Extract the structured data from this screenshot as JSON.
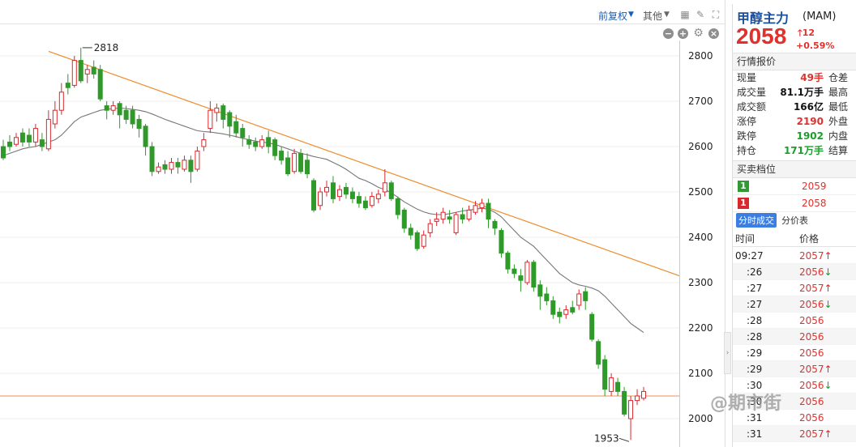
{
  "toolbar": {
    "fuquan_label": "前复权",
    "other_label": "其他"
  },
  "chart_data": {
    "type": "candlestick",
    "ylim": [
      1945,
      2830
    ],
    "yticks": [
      2000,
      2100,
      2200,
      2300,
      2400,
      2500,
      2600,
      2700,
      2800
    ],
    "annotations": [
      {
        "text": "2818",
        "value": 2818
      },
      {
        "text": "1953",
        "value": 1953
      }
    ],
    "candles": [
      [
        2600,
        2575,
        2615,
        2570
      ],
      [
        2610,
        2600,
        2625,
        2590
      ],
      [
        2605,
        2620,
        2630,
        2600
      ],
      [
        2630,
        2610,
        2640,
        2600
      ],
      [
        2625,
        2610,
        2640,
        2600
      ],
      [
        2610,
        2640,
        2650,
        2600
      ],
      [
        2615,
        2600,
        2630,
        2590
      ],
      [
        2595,
        2660,
        2680,
        2590
      ],
      [
        2650,
        2680,
        2700,
        2640
      ],
      [
        2680,
        2720,
        2740,
        2670
      ],
      [
        2740,
        2730,
        2760,
        2715
      ],
      [
        2735,
        2790,
        2800,
        2730
      ],
      [
        2790,
        2745,
        2818,
        2740
      ],
      [
        2760,
        2770,
        2780,
        2740
      ],
      [
        2775,
        2760,
        2790,
        2750
      ],
      [
        2770,
        2705,
        2780,
        2700
      ],
      [
        2690,
        2680,
        2700,
        2660
      ],
      [
        2680,
        2690,
        2700,
        2670
      ],
      [
        2695,
        2670,
        2700,
        2640
      ],
      [
        2680,
        2660,
        2690,
        2650
      ],
      [
        2680,
        2650,
        2690,
        2640
      ],
      [
        2660,
        2640,
        2670,
        2620
      ],
      [
        2645,
        2600,
        2650,
        2580
      ],
      [
        2600,
        2545,
        2610,
        2535
      ],
      [
        2545,
        2555,
        2565,
        2540
      ],
      [
        2560,
        2550,
        2570,
        2540
      ],
      [
        2550,
        2565,
        2575,
        2540
      ],
      [
        2565,
        2555,
        2575,
        2540
      ],
      [
        2550,
        2570,
        2580,
        2545
      ],
      [
        2570,
        2545,
        2580,
        2520
      ],
      [
        2550,
        2590,
        2600,
        2545
      ],
      [
        2600,
        2615,
        2630,
        2590
      ],
      [
        2640,
        2680,
        2700,
        2630
      ],
      [
        2675,
        2685,
        2695,
        2655
      ],
      [
        2690,
        2660,
        2695,
        2640
      ],
      [
        2675,
        2645,
        2680,
        2620
      ],
      [
        2655,
        2630,
        2670,
        2620
      ],
      [
        2640,
        2620,
        2650,
        2600
      ],
      [
        2615,
        2605,
        2625,
        2595
      ],
      [
        2610,
        2600,
        2620,
        2590
      ],
      [
        2600,
        2615,
        2625,
        2595
      ],
      [
        2620,
        2600,
        2635,
        2585
      ],
      [
        2615,
        2580,
        2620,
        2570
      ],
      [
        2590,
        2570,
        2600,
        2560
      ],
      [
        2575,
        2540,
        2590,
        2535
      ],
      [
        2545,
        2585,
        2595,
        2540
      ],
      [
        2585,
        2545,
        2595,
        2540
      ],
      [
        2570,
        2540,
        2585,
        2530
      ],
      [
        2525,
        2460,
        2530,
        2455
      ],
      [
        2470,
        2500,
        2510,
        2460
      ],
      [
        2500,
        2510,
        2525,
        2490
      ],
      [
        2520,
        2485,
        2535,
        2475
      ],
      [
        2490,
        2505,
        2515,
        2480
      ],
      [
        2510,
        2495,
        2520,
        2485
      ],
      [
        2500,
        2485,
        2510,
        2475
      ],
      [
        2490,
        2475,
        2500,
        2465
      ],
      [
        2480,
        2465,
        2490,
        2460
      ],
      [
        2470,
        2490,
        2500,
        2465
      ],
      [
        2485,
        2495,
        2505,
        2475
      ],
      [
        2500,
        2520,
        2550,
        2490
      ],
      [
        2520,
        2485,
        2525,
        2480
      ],
      [
        2485,
        2450,
        2490,
        2440
      ],
      [
        2460,
        2420,
        2465,
        2410
      ],
      [
        2420,
        2405,
        2430,
        2395
      ],
      [
        2410,
        2375,
        2415,
        2370
      ],
      [
        2380,
        2405,
        2415,
        2375
      ],
      [
        2410,
        2430,
        2440,
        2400
      ],
      [
        2435,
        2440,
        2455,
        2425
      ],
      [
        2440,
        2455,
        2465,
        2430
      ],
      [
        2445,
        2440,
        2460,
        2430
      ],
      [
        2410,
        2450,
        2455,
        2405
      ],
      [
        2450,
        2440,
        2465,
        2430
      ],
      [
        2440,
        2460,
        2470,
        2435
      ],
      [
        2455,
        2470,
        2480,
        2450
      ],
      [
        2465,
        2475,
        2485,
        2455
      ],
      [
        2475,
        2440,
        2485,
        2420
      ],
      [
        2435,
        2420,
        2440,
        2405
      ],
      [
        2415,
        2365,
        2420,
        2355
      ],
      [
        2365,
        2330,
        2370,
        2320
      ],
      [
        2330,
        2320,
        2340,
        2310
      ],
      [
        2315,
        2305,
        2330,
        2280
      ],
      [
        2300,
        2345,
        2350,
        2295
      ],
      [
        2345,
        2290,
        2350,
        2280
      ],
      [
        2295,
        2270,
        2305,
        2240
      ],
      [
        2275,
        2260,
        2290,
        2250
      ],
      [
        2260,
        2230,
        2270,
        2220
      ],
      [
        2235,
        2225,
        2245,
        2210
      ],
      [
        2230,
        2240,
        2250,
        2220
      ],
      [
        2245,
        2235,
        2260,
        2230
      ],
      [
        2250,
        2275,
        2285,
        2240
      ],
      [
        2280,
        2260,
        2290,
        2240
      ],
      [
        2230,
        2175,
        2235,
        2170
      ],
      [
        2170,
        2120,
        2175,
        2110
      ],
      [
        2130,
        2065,
        2140,
        2050
      ],
      [
        2060,
        2090,
        2100,
        2050
      ],
      [
        2080,
        2060,
        2090,
        2050
      ],
      [
        2060,
        2010,
        2070,
        2005
      ],
      [
        2000,
        2040,
        2050,
        1953
      ],
      [
        2040,
        2050,
        2065,
        2030
      ],
      [
        2045,
        2060,
        2070,
        2040
      ]
    ],
    "ma": [
      2580,
      2585,
      2590,
      2595,
      2598,
      2600,
      2605,
      2610,
      2615,
      2625,
      2640,
      2655,
      2665,
      2670,
      2675,
      2680,
      2682,
      2684,
      2685,
      2684,
      2682,
      2680,
      2677,
      2672,
      2666,
      2660,
      2655,
      2650,
      2645,
      2640,
      2635,
      2633,
      2632,
      2630,
      2628,
      2625,
      2622,
      2618,
      2615,
      2612,
      2610,
      2608,
      2605,
      2600,
      2595,
      2590,
      2585,
      2582,
      2578,
      2575,
      2572,
      2565,
      2558,
      2550,
      2540,
      2530,
      2525,
      2518,
      2510,
      2505,
      2498,
      2488,
      2478,
      2470,
      2462,
      2456,
      2452,
      2450,
      2450,
      2452,
      2455,
      2458,
      2460,
      2462,
      2464,
      2462,
      2455,
      2445,
      2430,
      2415,
      2400,
      2390,
      2380,
      2365,
      2350,
      2335,
      2320,
      2310,
      2300,
      2295,
      2292,
      2288,
      2282,
      2270,
      2255,
      2240,
      2225,
      2210,
      2200,
      2190
    ],
    "trendline": [
      [
        2810,
        0
      ],
      [
        2315,
        98
      ]
    ],
    "horizontal_line": 2050
  },
  "quote": {
    "name": "甲醇主力",
    "code": "(MAM)",
    "last": "2058",
    "change": "12",
    "change_pct": "+0.59%",
    "section_title": "行情报价",
    "rows": [
      {
        "label": "现量",
        "value": "49手",
        "color": "red",
        "label2": "仓差"
      },
      {
        "label": "成交量",
        "value": "81.1万手",
        "color": "black",
        "label2": "最高"
      },
      {
        "label": "成交额",
        "value": "166亿",
        "color": "black",
        "label2": "最低"
      },
      {
        "label": "涨停",
        "value": "2190",
        "color": "red",
        "label2": "外盘"
      },
      {
        "label": "跌停",
        "value": "1902",
        "color": "green",
        "label2": "内盘"
      },
      {
        "label": "持仓",
        "value": "171万手",
        "color": "green",
        "label2": "结算"
      }
    ]
  },
  "orderbook": {
    "title": "买卖档位",
    "rows": [
      {
        "level": "1",
        "price": "2059",
        "side": "sell"
      },
      {
        "level": "1",
        "price": "2058",
        "side": "buy"
      }
    ]
  },
  "ticks": {
    "tab_active": "分时成交",
    "tab_other": "分价表",
    "col_time": "时间",
    "col_price": "价格",
    "rows": [
      {
        "time": "09:27",
        "price": "2057",
        "dir": "up"
      },
      {
        "time": ":26",
        "price": "2056",
        "dir": "down"
      },
      {
        "time": ":27",
        "price": "2057",
        "dir": "up"
      },
      {
        "time": ":27",
        "price": "2056",
        "dir": "down"
      },
      {
        "time": ":28",
        "price": "2056",
        "dir": ""
      },
      {
        "time": ":28",
        "price": "2056",
        "dir": ""
      },
      {
        "time": ":29",
        "price": "2056",
        "dir": ""
      },
      {
        "time": ":29",
        "price": "2057",
        "dir": "up"
      },
      {
        "time": ":30",
        "price": "2056",
        "dir": "down"
      },
      {
        "time": ":30",
        "price": "2056",
        "dir": ""
      },
      {
        "time": ":31",
        "price": "2056",
        "dir": ""
      },
      {
        "time": ":31",
        "price": "2057",
        "dir": "up"
      }
    ]
  },
  "watermark": "@期市街"
}
